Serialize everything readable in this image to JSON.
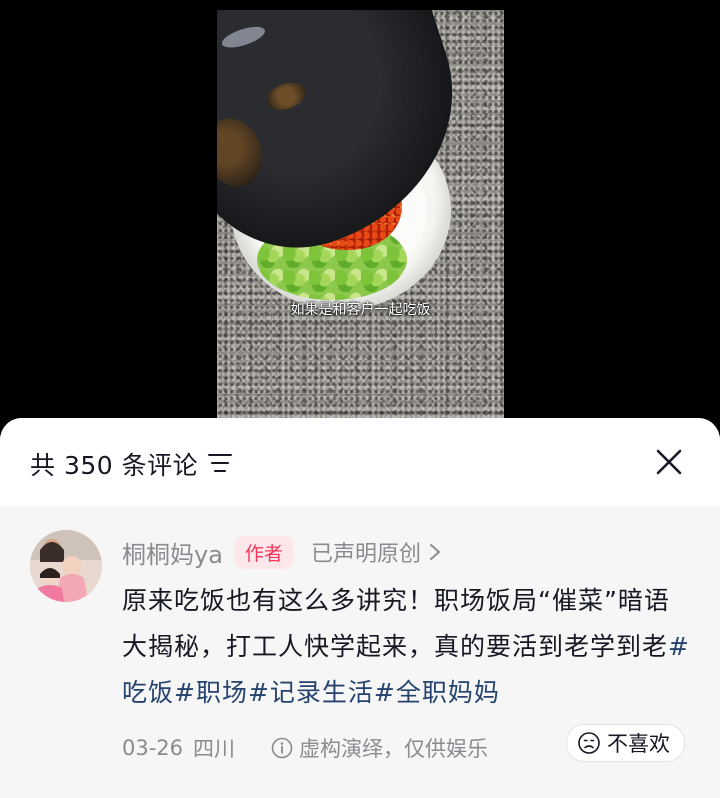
{
  "video": {
    "subtitle": "如果是和客户一起吃饭"
  },
  "comments_panel": {
    "title": "共 350 条评论",
    "filter_icon": "filter-icon",
    "close_icon": "close-icon"
  },
  "comment": {
    "author": "桐桐妈ya",
    "author_badge": "作者",
    "original_label": "已声明原创",
    "text": "原来吃饭也有这么多讲究！职场饭局“催菜”暗语大揭秘，打工人快学起来，真的要活到老学到老",
    "hashtags": [
      "#吃饭",
      "#职场",
      "#记录生活",
      "#全职妈妈"
    ],
    "date": "03-26",
    "region": "四川",
    "disclaimer": "虚构演绎，仅供娱乐",
    "dislike_label": "不喜欢"
  },
  "colors": {
    "badge_text": "#f2385a",
    "badge_bg": "#fde7ea",
    "hashtag": "#25436e",
    "secondary_text": "#8a8b91"
  }
}
